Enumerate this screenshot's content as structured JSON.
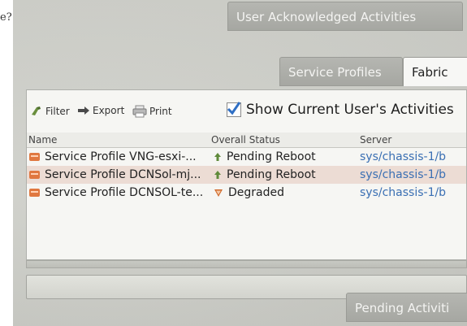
{
  "edge_text": "e?",
  "tabs": {
    "top": "User Acknowledged Activities",
    "sub_active": "Service Profiles",
    "sub_other": "Fabric",
    "bottom": "Pending Activiti"
  },
  "toolbar": {
    "filter": "Filter",
    "export": "Export",
    "print": "Print",
    "show_current": "Show Current User's Activities",
    "show_current_checked": true
  },
  "table": {
    "headers": [
      "Name",
      "Overall Status",
      "Server"
    ],
    "rows": [
      {
        "name": "Service Profile VNG-esxi-...",
        "status": "Pending Reboot",
        "status_icon": "up-arrow-icon",
        "server": "sys/chassis-1/b"
      },
      {
        "name": "Service Profile DCNSol-mj...",
        "status": "Pending Reboot",
        "status_icon": "up-arrow-icon",
        "server": "sys/chassis-1/b"
      },
      {
        "name": "Service Profile DCNSOL-te...",
        "status": "Degraded",
        "status_icon": "down-triangle-icon",
        "server": "sys/chassis-1/b"
      }
    ]
  },
  "colors": {
    "server_link": "#3a6fb3",
    "pending_icon": "#5f8a3a",
    "degraded_icon": "#d06a2c",
    "alt_row": "#ecdcd4"
  }
}
